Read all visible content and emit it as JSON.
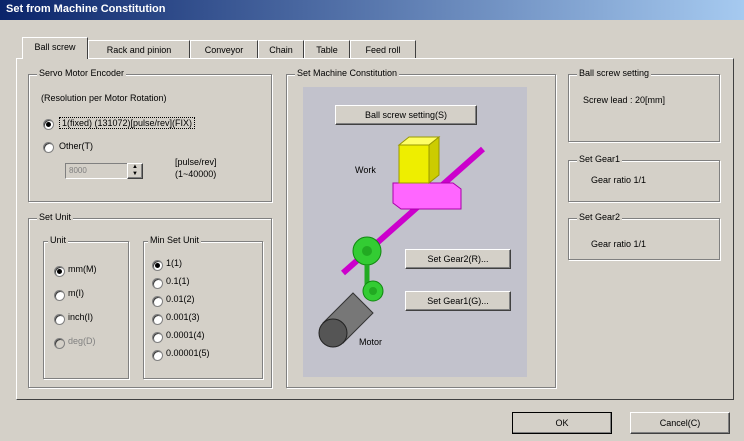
{
  "window": {
    "title": "Set from Machine Constitution"
  },
  "tabs": [
    "Ball screw",
    "Rack and pinion",
    "Conveyor",
    "Chain",
    "Table",
    "Feed roll"
  ],
  "encoder": {
    "group": "Servo Motor Encoder",
    "caption": "(Resolution per Motor Rotation)",
    "option1": "1(fixed) (131072)[pulse/rev](FIX)",
    "option2": "Other(T)",
    "other_value": "8000",
    "other_unit": "[pulse/rev]",
    "other_range": "(1~40000)"
  },
  "set_unit": {
    "group": "Set Unit",
    "unit_group": "Unit",
    "units": [
      "mm(M)",
      "m(I)",
      "inch(I)",
      "deg(D)"
    ],
    "min_group": "Min Set Unit",
    "mins": [
      "1(1)",
      "0.1(1)",
      "0.01(2)",
      "0.001(3)",
      "0.0001(4)",
      "0.00001(5)"
    ]
  },
  "machine": {
    "group": "Set Machine Constitution",
    "ball_screw_button": "Ball screw setting(S)",
    "work_label": "Work",
    "motor_label": "Motor",
    "gear2_button": "Set Gear2(R)...",
    "gear1_button": "Set Gear1(G)..."
  },
  "ball_screw": {
    "group": "Ball screw setting",
    "lead": "Screw lead : 20[mm]"
  },
  "gear1": {
    "group": "Set Gear1",
    "ratio": "Gear ratio 1/1"
  },
  "gear2": {
    "group": "Set Gear2",
    "ratio": "Gear ratio 1/1"
  },
  "buttons": {
    "ok": "OK",
    "cancel": "Cancel(C)"
  }
}
